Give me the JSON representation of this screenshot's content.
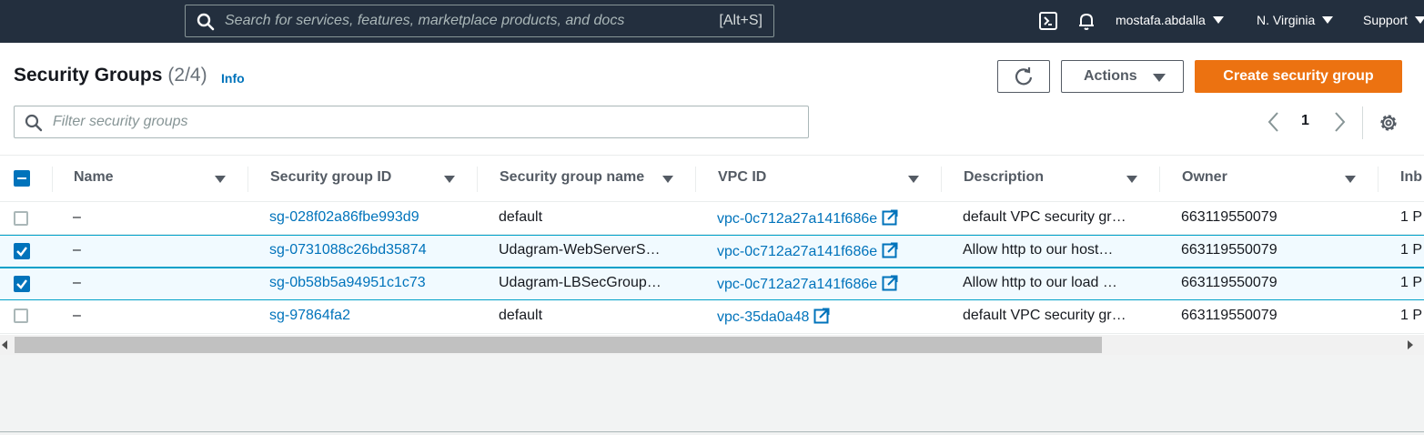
{
  "topnav": {
    "search_placeholder": "Search for services, features, marketplace products, and docs",
    "search_shortcut": "[Alt+S]",
    "user": "mostafa.abdalla",
    "region": "N. Virginia",
    "support": "Support"
  },
  "header": {
    "title": "Security Groups",
    "count": "(2/4)",
    "info": "Info",
    "actions_label": "Actions",
    "create_label": "Create security group"
  },
  "filter": {
    "placeholder": "Filter security groups"
  },
  "pagination": {
    "current_page": "1"
  },
  "table": {
    "columns": [
      "Name",
      "Security group ID",
      "Security group name",
      "VPC ID",
      "Description",
      "Owner",
      "Inb"
    ],
    "rows": [
      {
        "selected": false,
        "name": "–",
        "sg_id": "sg-028f02a86fbe993d9",
        "sg_name": "default",
        "vpc_id": "vpc-0c712a27a141f686e",
        "description": "default VPC security gr…",
        "owner": "663119550079",
        "inbound": "1 P"
      },
      {
        "selected": true,
        "name": "–",
        "sg_id": "sg-0731088c26bd35874",
        "sg_name": "Udagram-WebServerS…",
        "vpc_id": "vpc-0c712a27a141f686e",
        "description": "Allow http to our host…",
        "owner": "663119550079",
        "inbound": "1 P"
      },
      {
        "selected": true,
        "name": "–",
        "sg_id": "sg-0b58b5a94951c1c73",
        "sg_name": "Udagram-LBSecGroup…",
        "vpc_id": "vpc-0c712a27a141f686e",
        "description": "Allow http to our load …",
        "owner": "663119550079",
        "inbound": "1 P"
      },
      {
        "selected": false,
        "name": "–",
        "sg_id": "sg-97864fa2",
        "sg_name": "default",
        "vpc_id": "vpc-35da0a48",
        "description": "default VPC security gr…",
        "owner": "663119550079",
        "inbound": "1 P"
      }
    ]
  },
  "colors": {
    "nav_bg": "#232f3e",
    "primary": "#ec7211",
    "link": "#0073bb",
    "selected_row": "#f1faff"
  }
}
